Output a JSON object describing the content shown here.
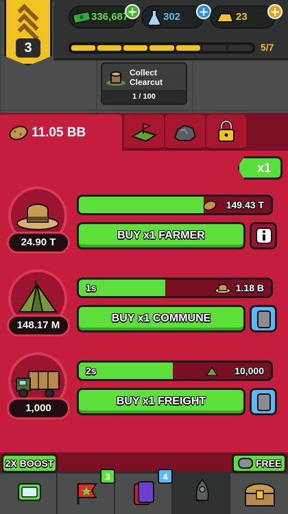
{
  "player": {
    "rank_level": "3",
    "xp_progress_text": "5/7",
    "xp_segments_filled": 5,
    "xp_segments_total": 7
  },
  "currencies": {
    "cash": "336,687",
    "science": "302",
    "gold": "23"
  },
  "mission": {
    "title": "Collect Clearcut",
    "progress": "1 / 100"
  },
  "resource": {
    "total": "11.05 BB"
  },
  "buy_multiplier": "x1",
  "businesses": [
    {
      "name": "farmer",
      "count": "24.90 T",
      "timer": "",
      "progress": 0.65,
      "payout": "149.43 T",
      "buy_label": "BUY x1 FARMER"
    },
    {
      "name": "commune",
      "count": "148.17 M",
      "timer": "1s",
      "progress": 0.45,
      "payout": "1.18 B",
      "buy_label": "BUY x1 COMMUNE"
    },
    {
      "name": "freight",
      "count": "1,000",
      "timer": "2s",
      "progress": 0.49,
      "payout": "10,000",
      "buy_label": "BUY x1 FREIGHT"
    }
  ],
  "promos": {
    "boost": "2X BOOST",
    "free": "FREE"
  },
  "nav": {
    "badge_missions": "3",
    "badge_cards": "4"
  },
  "colors": {
    "brand_red": "#c41e3c",
    "action_green": "#5ee03a",
    "gold": "#f2c122",
    "hud_gray": "#4a4f4d"
  }
}
